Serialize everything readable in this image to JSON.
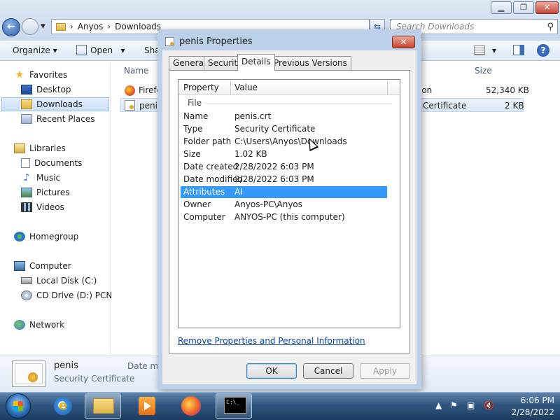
{
  "explorer": {
    "window_controls": {
      "minimize": "▁",
      "maximize": "❐",
      "close": "✕"
    },
    "breadcrumb": [
      "Anyos",
      "Downloads"
    ],
    "search_placeholder": "Search Downloads",
    "commands": {
      "organize": "Organize",
      "open": "Open",
      "share": "Sha"
    },
    "nav": {
      "favorites": "Favorites",
      "desktop": "Desktop",
      "downloads": "Downloads",
      "recent": "Recent Places",
      "libraries": "Libraries",
      "documents": "Documents",
      "music": "Music",
      "pictures": "Pictures",
      "videos": "Videos",
      "homegroup": "Homegroup",
      "computer": "Computer",
      "local_disk": "Local Disk (C:)",
      "cd_drive": "CD Drive (D:) PCNet",
      "network": "Network"
    },
    "columns": {
      "name": "Name",
      "size": "Size"
    },
    "files": [
      {
        "name": "Firefo",
        "type": "ion",
        "size": "52,340 KB"
      },
      {
        "name": "penis",
        "type": "Certificate",
        "size": "2 KB"
      }
    ],
    "details_pane": {
      "name": "penis",
      "type": "Security Certificate",
      "date_label": "Date mo"
    }
  },
  "dialog": {
    "title": "penis Properties",
    "close": "✕",
    "tabs": [
      "General",
      "Security",
      "Details",
      "Previous Versions"
    ],
    "active_tab": "Details",
    "grid_headers": {
      "property": "Property",
      "value": "Value"
    },
    "group": "File",
    "properties": [
      {
        "key": "Name",
        "value": "penis.crt"
      },
      {
        "key": "Type",
        "value": "Security Certificate"
      },
      {
        "key": "Folder path",
        "value": "C:\\Users\\Anyos\\Downloads"
      },
      {
        "key": "Size",
        "value": "1.02 KB"
      },
      {
        "key": "Date created",
        "value": "2/28/2022 6:03 PM"
      },
      {
        "key": "Date modified",
        "value": "2/28/2022 6:03 PM"
      },
      {
        "key": "Attributes",
        "value": "AI"
      },
      {
        "key": "Owner",
        "value": "Anyos-PC\\Anyos"
      },
      {
        "key": "Computer",
        "value": "ANYOS-PC (this computer)"
      }
    ],
    "selected_row": "Attributes",
    "remove_link": "Remove Properties and Personal Information",
    "buttons": {
      "ok": "OK",
      "cancel": "Cancel",
      "apply": "Apply"
    }
  },
  "taskbar": {
    "cmd_label": "C:\\_",
    "clock_time": "6:06 PM",
    "clock_date": "2/28/2022"
  }
}
